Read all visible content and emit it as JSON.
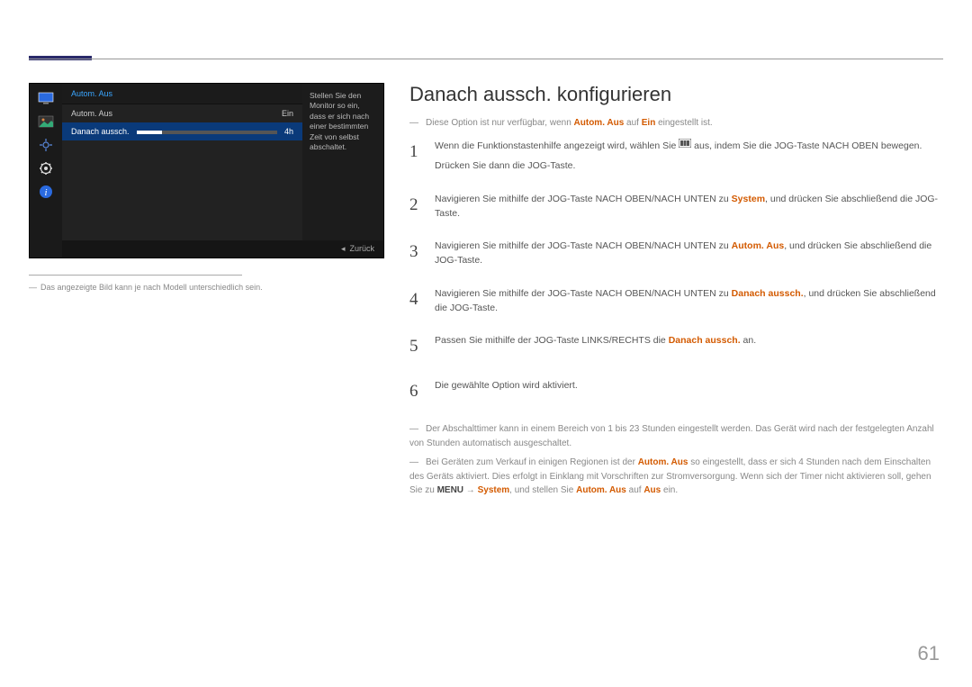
{
  "page_number": "61",
  "osd": {
    "header": "Autom. Aus",
    "row1_label": "Autom. Aus",
    "row1_value": "Ein",
    "row2_label": "Danach aussch.",
    "row2_value": "4h",
    "side_text": "Stellen Sie den Monitor so ein, dass er sich nach einer bestimmten Zeit von selbst abschaltet.",
    "back_label": "Zurück"
  },
  "left_note_pre": "― ",
  "left_note": "Das angezeigte Bild kann je nach Modell unterschiedlich sein.",
  "heading": "Danach aussch. konfigurieren",
  "intro_dash": "―",
  "intro_a": "Diese Option ist nur verfügbar, wenn ",
  "intro_hl1": "Autom. Aus",
  "intro_b": " auf ",
  "intro_hl2": "Ein",
  "intro_c": " eingestellt ist.",
  "s1_num": "1",
  "s1_a": "Wenn die Funktionstastenhilfe angezeigt wird, wählen Sie ",
  "s1_b": " aus, indem Sie die JOG-Taste NACH OBEN bewegen.",
  "s1_c": "Drücken Sie dann die JOG-Taste.",
  "s2_num": "2",
  "s2_a": "Navigieren Sie mithilfe der JOG-Taste NACH OBEN/NACH UNTEN zu ",
  "s2_hl": "System",
  "s2_b": ", und drücken Sie abschließend die JOG-Taste.",
  "s3_num": "3",
  "s3_a": "Navigieren Sie mithilfe der JOG-Taste NACH OBEN/NACH UNTEN zu ",
  "s3_hl": "Autom. Aus",
  "s3_b": ", und drücken Sie abschließend die JOG-Taste.",
  "s4_num": "4",
  "s4_a": "Navigieren Sie mithilfe der JOG-Taste NACH OBEN/NACH UNTEN zu ",
  "s4_hl": "Danach aussch.",
  "s4_b": ", und drücken Sie abschließend die JOG-Taste.",
  "s5_num": "5",
  "s5_a": "Passen Sie mithilfe der JOG-Taste LINKS/RECHTS die ",
  "s5_hl": "Danach aussch.",
  "s5_b": " an.",
  "s6_num": "6",
  "s6_a": "Die gewählte Option wird aktiviert.",
  "note1": "Der Abschalttimer kann in einem Bereich von 1 bis 23 Stunden eingestellt werden. Das Gerät wird nach der festgelegten Anzahl von Stunden automatisch ausgeschaltet.",
  "note2_a": "Bei Geräten zum Verkauf in einigen Regionen ist der ",
  "note2_hl1": "Autom. Aus",
  "note2_b": " so eingestellt, dass er sich 4 Stunden nach dem Einschalten des Geräts aktiviert. Dies erfolgt in Einklang mit Vorschriften zur Stromversorgung. Wenn sich der Timer nicht aktivieren soll, gehen Sie zu ",
  "note2_bold1": "MENU",
  "note2_arrow": " → ",
  "note2_hl2": "System",
  "note2_c": ", und stellen Sie ",
  "note2_hl3": "Autom. Aus",
  "note2_d": " auf ",
  "note2_hl4": "Aus",
  "note2_e": " ein."
}
